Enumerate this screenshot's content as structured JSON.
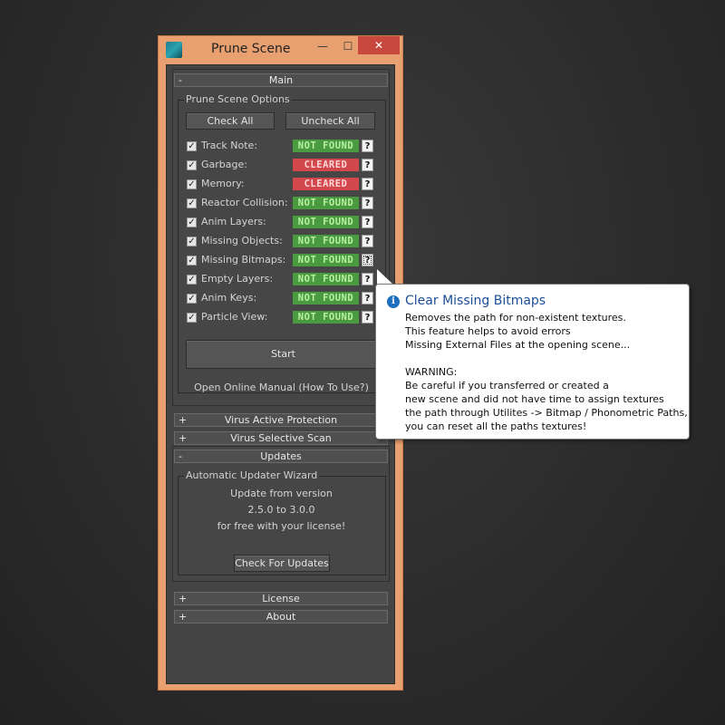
{
  "window": {
    "title": "Prune Scene",
    "controls": {
      "minimize": "—",
      "maximize": "☐",
      "close": "✕"
    }
  },
  "main_rollout": {
    "sign": "-",
    "label": "Main",
    "group_title": "Prune Scene Options",
    "check_all": "Check All",
    "uncheck_all": "Uncheck All",
    "options": [
      {
        "label": "Track Note:",
        "checked": true,
        "status": "NOT FOUND",
        "kind": "ok"
      },
      {
        "label": "Garbage:",
        "checked": true,
        "status": "CLEARED",
        "kind": "cleared"
      },
      {
        "label": "Memory:",
        "checked": true,
        "status": "CLEARED",
        "kind": "cleared"
      },
      {
        "label": "Reactor Collision:",
        "checked": true,
        "status": "NOT FOUND",
        "kind": "ok"
      },
      {
        "label": "Anim Layers:",
        "checked": true,
        "status": "NOT FOUND",
        "kind": "ok"
      },
      {
        "label": "Missing Objects:",
        "checked": true,
        "status": "NOT FOUND",
        "kind": "ok"
      },
      {
        "label": "Missing Bitmaps:",
        "checked": true,
        "status": "NOT FOUND",
        "kind": "ok"
      },
      {
        "label": "Empty Layers:",
        "checked": true,
        "status": "NOT FOUND",
        "kind": "ok"
      },
      {
        "label": "Anim Keys:",
        "checked": true,
        "status": "NOT FOUND",
        "kind": "ok"
      },
      {
        "label": "Particle View:",
        "checked": true,
        "status": "NOT FOUND",
        "kind": "ok"
      }
    ],
    "help_label": "?",
    "start": "Start",
    "manual_link": "Open Online Manual (How To Use?)"
  },
  "rollouts_collapsed_1": [
    {
      "sign": "+",
      "label": "Virus Active Protection"
    },
    {
      "sign": "+",
      "label": "Virus Selective Scan"
    }
  ],
  "updates_rollout": {
    "sign": "-",
    "label": "Updates",
    "group_title": "Automatic Updater Wizard",
    "line1": "Update from version",
    "line2": "2.5.0 to 3.0.0",
    "line3": "for free with your license!",
    "check_button": "Check For Updates"
  },
  "rollouts_collapsed_2": [
    {
      "sign": "+",
      "label": "License"
    },
    {
      "sign": "+",
      "label": "About"
    }
  ],
  "tooltip": {
    "icon": "i",
    "title": "Clear Missing Bitmaps",
    "lines": [
      "Removes the path for non-existent textures.",
      "This feature helps to avoid errors",
      "Missing External Files at the opening scene...",
      "",
      "WARNING:",
      "Be careful if you transferred or created a",
      "new scene and did not have time to assign textures",
      "the path through Utilites -> Bitmap / Phonometric Paths,",
      "you can reset all the paths textures!"
    ]
  },
  "colors": {
    "window_border": "#e8a070",
    "panel_bg": "#444444",
    "not_found_bg": "#4a9a3f",
    "cleared_bg": "#d2474b",
    "tooltip_title": "#1c4e98"
  }
}
